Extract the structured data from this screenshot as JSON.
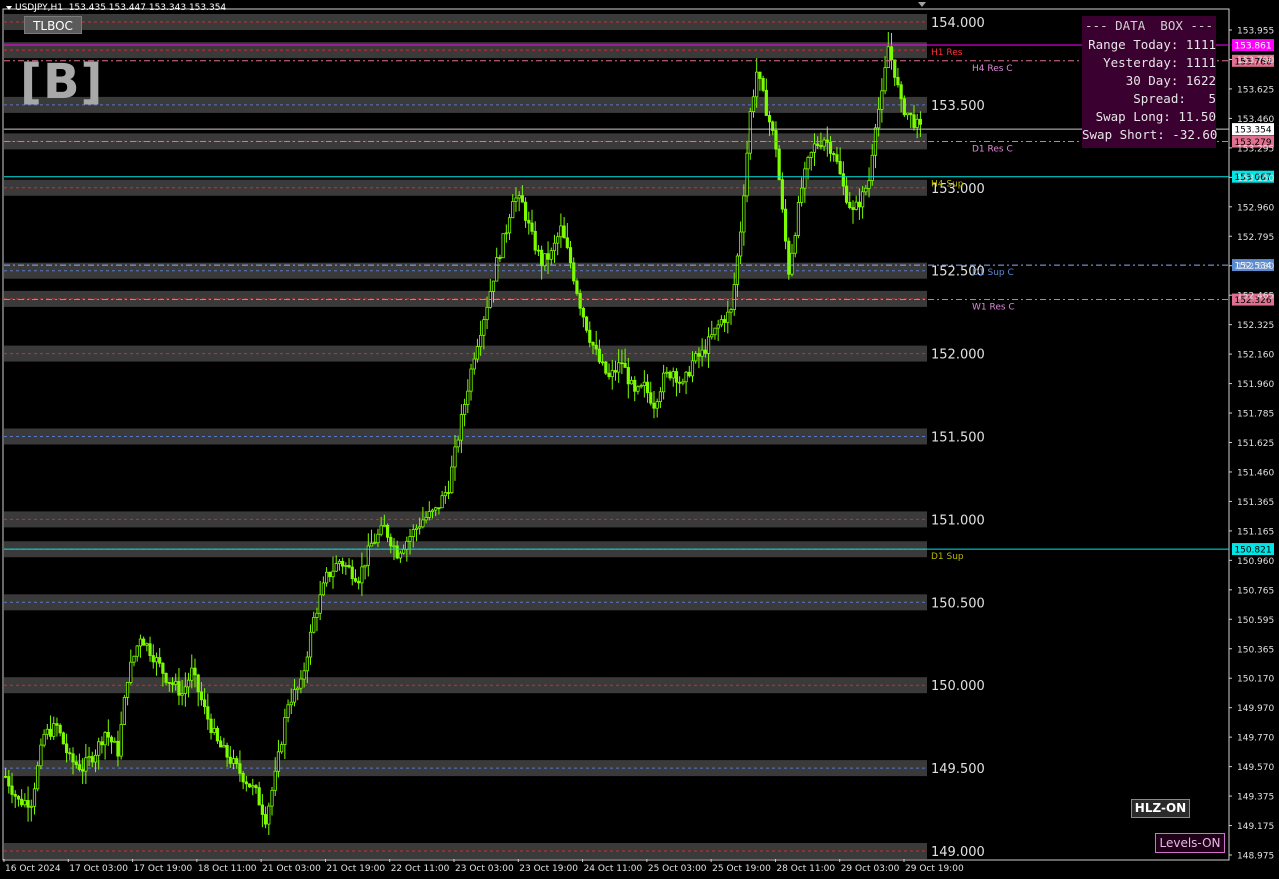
{
  "header": {
    "symbol": "USDJPY,H1",
    "ohlc": "153.435 153.447 153.343 153.354"
  },
  "tlboc_button": "TLBOC",
  "logo_text": "[B]",
  "data_box": {
    "title": "--- DATA  BOX ---",
    "lines": [
      "Range Today: 1111",
      "Yesterday: 1111",
      "30 Day: 1622",
      "Spread:   5",
      "Swap Long: 11.50",
      "Swap Short: -32.60"
    ]
  },
  "buttons": {
    "hlz": "HLZ-ON",
    "levels": "Levels-ON"
  },
  "colors": {
    "background": "#000000",
    "candle": "#7CFC00",
    "zone": "#3a3a3a",
    "red_dash": "#c83232",
    "blue_dash": "#5a78c8",
    "cyan": "#00e5e5",
    "magenta": "#ff00ff",
    "pink": "#e07090",
    "white": "#ffffff"
  },
  "chart_data": {
    "type": "candlestick",
    "symbol": "USDJPY",
    "timeframe": "H1",
    "ylim": [
      148.975,
      154.05
    ],
    "round_levels": [
      154.0,
      153.5,
      153.0,
      152.5,
      152.0,
      151.5,
      151.0,
      150.5,
      150.0,
      149.5,
      149.0
    ],
    "round_level_labels": [
      "154.000",
      "153.500",
      "153.000",
      "152.500",
      "152.000",
      "151.500",
      "151.000",
      "150.500",
      "150.000",
      "149.500",
      "149.000"
    ],
    "zones": [
      {
        "price": 154.0,
        "style": "red"
      },
      {
        "price": 153.83,
        "style": "red"
      },
      {
        "price": 153.5,
        "style": "blue"
      },
      {
        "price": 153.28,
        "style": "red"
      },
      {
        "price": 153.0,
        "style": "red"
      },
      {
        "price": 152.5,
        "style": "blue"
      },
      {
        "price": 152.33,
        "style": "red"
      },
      {
        "price": 152.0,
        "style": "red"
      },
      {
        "price": 151.5,
        "style": "blue"
      },
      {
        "price": 151.0,
        "style": "red"
      },
      {
        "price": 150.82,
        "style": "red"
      },
      {
        "price": 150.5,
        "style": "blue"
      },
      {
        "price": 150.0,
        "style": "red"
      },
      {
        "price": 149.5,
        "style": "blue"
      },
      {
        "price": 149.0,
        "style": "red"
      }
    ],
    "levels": [
      {
        "name": "H1 Res",
        "price": 153.861,
        "tag": "153.861",
        "color": "#ff00ff",
        "style": "solid",
        "tag_bg": "#ff00ff",
        "tag_fg": "#ffffff"
      },
      {
        "name": "H4 Res C",
        "price": 153.766,
        "tag": "153.766",
        "color": "#e07090",
        "style": "dashdot",
        "tag_bg": "#e07090",
        "tag_fg": "#000000"
      },
      {
        "name": "",
        "price": 153.354,
        "tag": "153.354",
        "color": "#c8c8c8",
        "style": "solid",
        "tag_bg": "#ffffff",
        "tag_fg": "#000000"
      },
      {
        "name": "D1 Res C",
        "price": 153.279,
        "tag": "153.279",
        "color": "#e07090",
        "style": "dashdot",
        "tag_bg": "#e07090",
        "tag_fg": "#000000"
      },
      {
        "name": "H4 Sup",
        "price": 153.067,
        "tag": "153.067",
        "color": "#00e5e5",
        "style": "solid",
        "tag_bg": "#00e5e5",
        "tag_fg": "#000000"
      },
      {
        "name": "D1 Sup C",
        "price": 152.534,
        "tag": "152.534",
        "color": "#88aaff",
        "style": "dashdot",
        "tag_bg": "#5a8ad0",
        "tag_fg": "#ffffff"
      },
      {
        "name": "W1 Res C",
        "price": 152.326,
        "tag": "152.326",
        "color": "#e07090",
        "style": "dashdot",
        "tag_bg": "#e07090",
        "tag_fg": "#000000"
      },
      {
        "name": "D1 Sup",
        "price": 150.821,
        "tag": "150.821",
        "color": "#00e5e5",
        "style": "solid",
        "tag_bg": "#00e5e5",
        "tag_fg": "#000000"
      }
    ],
    "level_label_colors": {
      "H1 Res": "#ff3030",
      "H4 Res C": "#e08ad8",
      "D1 Res C": "#e08ad8",
      "H4 Sup": "#b8b800",
      "D1 Sup C": "#5a8ad0",
      "W1 Res C": "#e08ad8",
      "D1 Sup": "#b8b800"
    },
    "price_axis_ticks": [
      "153.955",
      "153.790",
      "153.625",
      "153.460",
      "153.295",
      "153.150",
      "152.960",
      "152.795",
      "152.630",
      "152.465",
      "152.325",
      "152.160",
      "151.960",
      "151.785",
      "151.625",
      "151.460",
      "151.365",
      "151.165",
      "150.960",
      "150.765",
      "150.595",
      "150.365",
      "150.170",
      "149.970",
      "149.770",
      "149.570",
      "149.375",
      "149.175",
      "148.975"
    ],
    "time_axis_labels": [
      "16 Oct 2024",
      "17 Oct 03:00",
      "17 Oct 19:00",
      "18 Oct 11:00",
      "21 Oct 03:00",
      "21 Oct 19:00",
      "22 Oct 11:00",
      "23 Oct 03:00",
      "23 Oct 19:00",
      "24 Oct 11:00",
      "25 Oct 03:00",
      "25 Oct 19:00",
      "28 Oct 11:00",
      "29 Oct 03:00",
      "29 Oct 19:00"
    ],
    "price_path": [
      [
        0,
        149.45
      ],
      [
        4,
        149.3
      ],
      [
        8,
        149.3
      ],
      [
        12,
        149.7
      ],
      [
        16,
        149.75
      ],
      [
        20,
        149.55
      ],
      [
        24,
        149.5
      ],
      [
        28,
        149.6
      ],
      [
        31,
        149.72
      ],
      [
        35,
        149.6
      ],
      [
        38,
        150.05
      ],
      [
        42,
        150.3
      ],
      [
        46,
        150.18
      ],
      [
        50,
        150.05
      ],
      [
        55,
        149.95
      ],
      [
        58,
        150.08
      ],
      [
        62,
        149.85
      ],
      [
        66,
        149.65
      ],
      [
        70,
        149.55
      ],
      [
        74,
        149.45
      ],
      [
        78,
        149.35
      ],
      [
        81,
        149.2
      ],
      [
        84,
        149.45
      ],
      [
        88,
        149.9
      ],
      [
        92,
        150.0
      ],
      [
        96,
        150.4
      ],
      [
        100,
        150.65
      ],
      [
        104,
        150.75
      ],
      [
        107,
        150.7
      ],
      [
        110,
        150.65
      ],
      [
        114,
        150.85
      ],
      [
        118,
        150.95
      ],
      [
        122,
        150.8
      ],
      [
        126,
        150.9
      ],
      [
        130,
        151.0
      ],
      [
        134,
        151.05
      ],
      [
        138,
        151.2
      ],
      [
        142,
        151.6
      ],
      [
        146,
        152.0
      ],
      [
        150,
        152.3
      ],
      [
        153,
        152.55
      ],
      [
        156,
        152.75
      ],
      [
        158,
        152.95
      ],
      [
        161,
        152.9
      ],
      [
        164,
        152.7
      ],
      [
        167,
        152.55
      ],
      [
        170,
        152.6
      ],
      [
        173,
        152.75
      ],
      [
        176,
        152.55
      ],
      [
        179,
        152.3
      ],
      [
        182,
        152.1
      ],
      [
        185,
        151.95
      ],
      [
        188,
        151.85
      ],
      [
        192,
        151.95
      ],
      [
        196,
        151.75
      ],
      [
        199,
        151.8
      ],
      [
        202,
        151.7
      ],
      [
        205,
        151.85
      ],
      [
        208,
        151.9
      ],
      [
        211,
        151.8
      ],
      [
        214,
        151.95
      ],
      [
        217,
        152.0
      ],
      [
        220,
        152.1
      ],
      [
        223,
        152.2
      ],
      [
        226,
        152.25
      ],
      [
        229,
        152.75
      ],
      [
        232,
        153.45
      ],
      [
        234,
        153.7
      ],
      [
        236,
        153.55
      ],
      [
        238,
        153.4
      ],
      [
        240,
        153.25
      ],
      [
        242,
        152.85
      ],
      [
        244,
        152.5
      ],
      [
        246,
        152.75
      ],
      [
        248,
        153.0
      ],
      [
        250,
        153.15
      ],
      [
        252,
        153.25
      ],
      [
        255,
        153.3
      ],
      [
        258,
        153.22
      ],
      [
        261,
        153.0
      ],
      [
        264,
        152.85
      ],
      [
        267,
        152.95
      ],
      [
        269,
        153.05
      ],
      [
        271,
        153.4
      ],
      [
        273,
        153.55
      ],
      [
        275,
        153.85
      ],
      [
        277,
        153.7
      ],
      [
        279,
        153.5
      ],
      [
        281,
        153.45
      ],
      [
        283,
        153.4
      ],
      [
        285,
        153.35
      ]
    ]
  }
}
